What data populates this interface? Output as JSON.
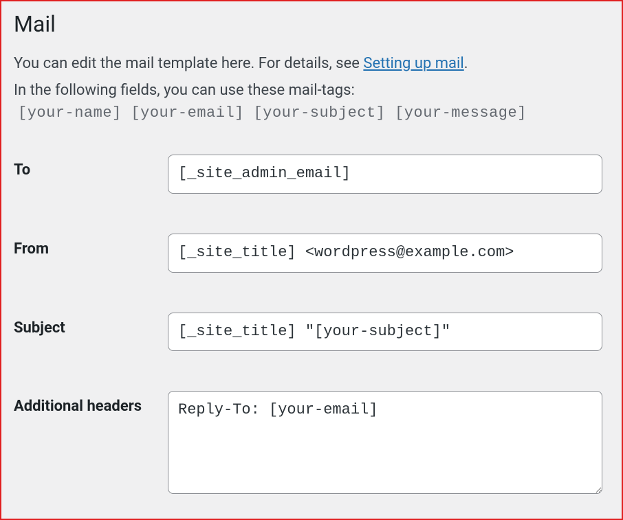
{
  "title": "Mail",
  "description": {
    "line1_prefix": "You can edit the mail template here. For details, see ",
    "link_text": "Setting up mail",
    "line1_suffix": ".",
    "line2": "In the following fields, you can use these mail-tags:"
  },
  "mail_tags": "[your-name] [your-email] [your-subject] [your-message]",
  "fields": {
    "to": {
      "label": "To",
      "value": "[_site_admin_email]"
    },
    "from": {
      "label": "From",
      "value": "[_site_title] <wordpress@example.com>"
    },
    "subject": {
      "label": "Subject",
      "value": "[_site_title] \"[your-subject]\""
    },
    "additional_headers": {
      "label": "Additional headers",
      "value": "Reply-To: [your-email]"
    }
  }
}
